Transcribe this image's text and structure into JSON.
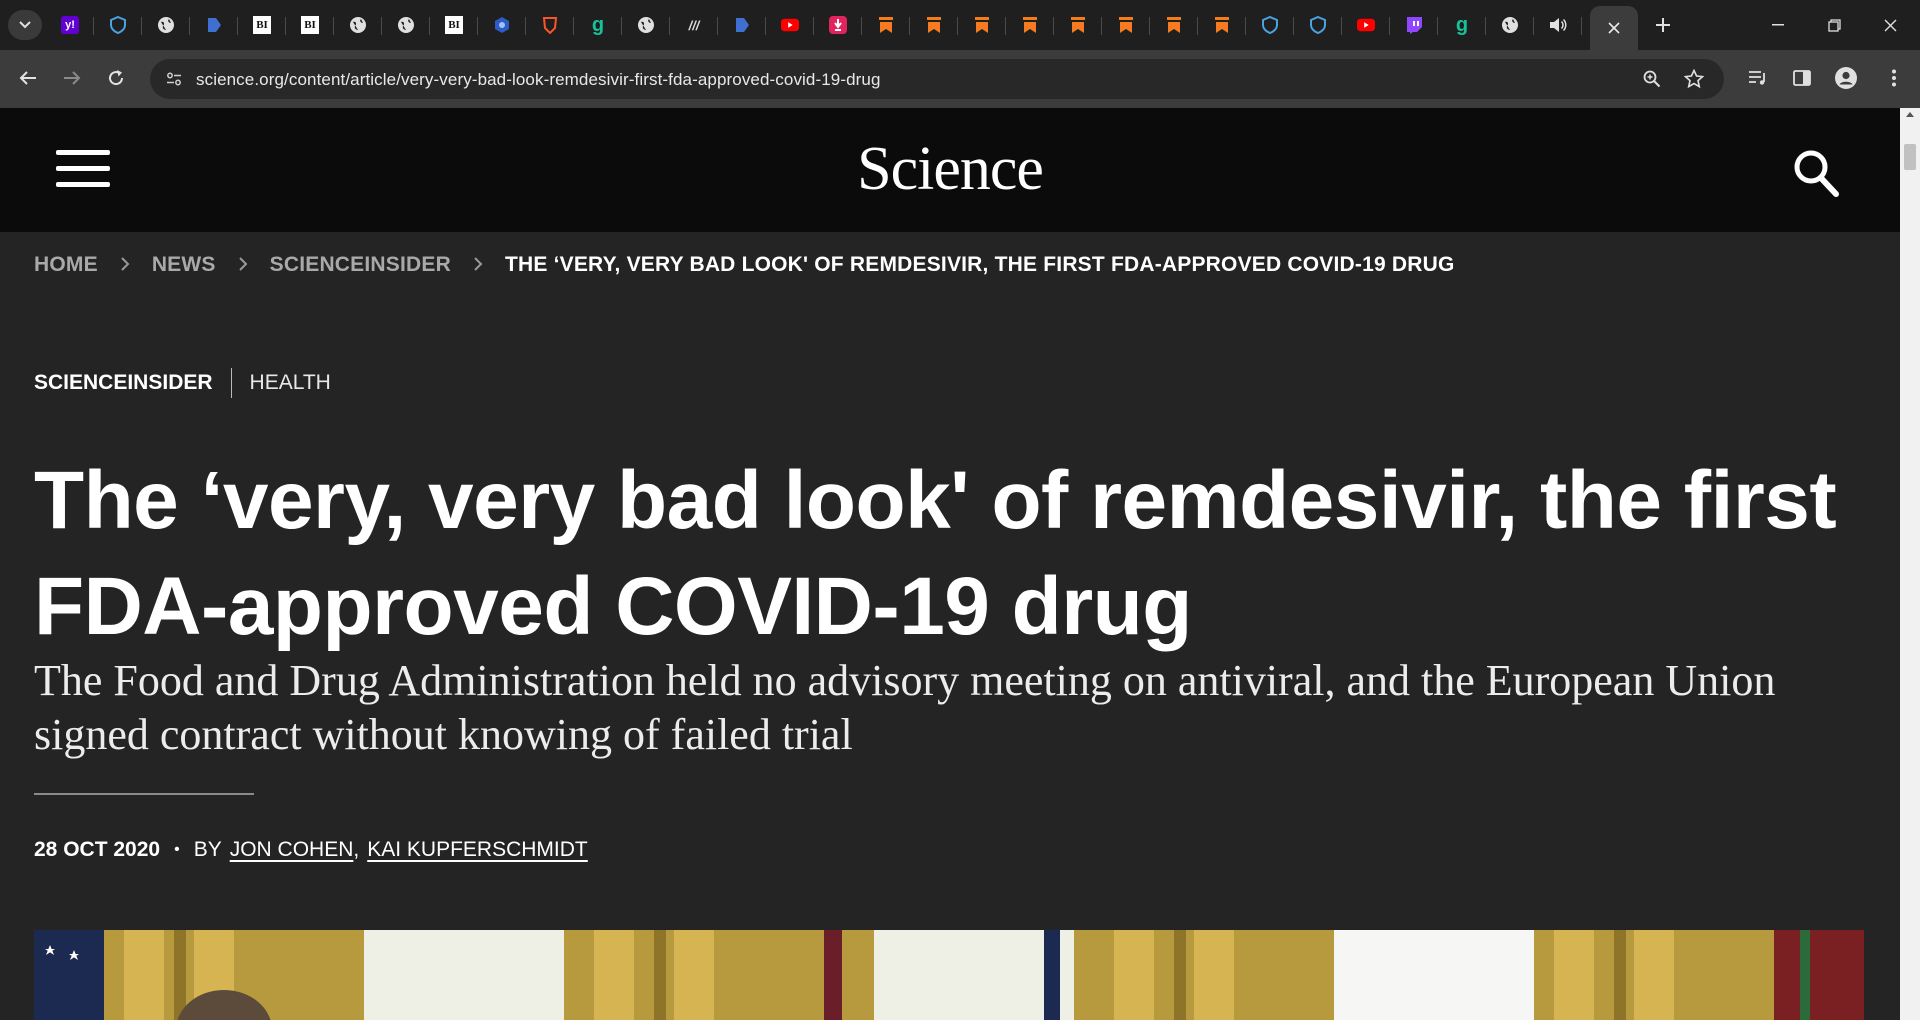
{
  "browser": {
    "tabs": [
      {
        "icon": "yahoo-icon",
        "glyph": "y!",
        "color": "#6001d2"
      },
      {
        "icon": "shield-icon",
        "glyph": "",
        "color": "#1f1f1f"
      },
      {
        "icon": "globe-icon",
        "glyph": "",
        "color": "#1f1f1f"
      },
      {
        "icon": "arrow-tab-icon",
        "glyph": "",
        "color": "#1f1f1f"
      },
      {
        "icon": "business-insider-icon",
        "glyph": "BI",
        "color": "#ffffff"
      },
      {
        "icon": "business-insider-icon",
        "glyph": "BI",
        "color": "#ffffff"
      },
      {
        "icon": "globe-icon",
        "glyph": "",
        "color": "#1f1f1f"
      },
      {
        "icon": "globe-icon",
        "glyph": "",
        "color": "#1f1f1f"
      },
      {
        "icon": "business-insider-icon",
        "glyph": "BI",
        "color": "#ffffff"
      },
      {
        "icon": "hexagon-icon",
        "glyph": "",
        "color": "#1f1f1f"
      },
      {
        "icon": "brave-shield-icon",
        "glyph": "",
        "color": "#1f1f1f"
      },
      {
        "icon": "grammarly-g-icon",
        "glyph": "g",
        "color": "#1f1f1f"
      },
      {
        "icon": "globe-icon",
        "glyph": "",
        "color": "#1f1f1f"
      },
      {
        "icon": "slash-tab-icon",
        "glyph": "",
        "color": "#1f1f1f"
      },
      {
        "icon": "arrow-tab-icon",
        "glyph": "",
        "color": "#1f1f1f"
      },
      {
        "icon": "youtube-icon",
        "glyph": "",
        "color": "#1f1f1f"
      },
      {
        "icon": "red-badge-icon",
        "glyph": "",
        "color": "#1f1f1f"
      },
      {
        "icon": "bookmark-orange-icon",
        "glyph": "",
        "color": "#1f1f1f"
      },
      {
        "icon": "bookmark-orange-icon",
        "glyph": "",
        "color": "#1f1f1f"
      },
      {
        "icon": "bookmark-orange-icon",
        "glyph": "",
        "color": "#1f1f1f"
      },
      {
        "icon": "bookmark-orange-icon",
        "glyph": "",
        "color": "#1f1f1f"
      },
      {
        "icon": "bookmark-orange-icon",
        "glyph": "",
        "color": "#1f1f1f"
      },
      {
        "icon": "bookmark-orange-icon",
        "glyph": "",
        "color": "#1f1f1f"
      },
      {
        "icon": "bookmark-orange-icon",
        "glyph": "",
        "color": "#1f1f1f"
      },
      {
        "icon": "bookmark-orange-icon",
        "glyph": "",
        "color": "#1f1f1f"
      },
      {
        "icon": "shield-icon",
        "glyph": "",
        "color": "#1f1f1f"
      },
      {
        "icon": "shield-icon",
        "glyph": "",
        "color": "#1f1f1f"
      },
      {
        "icon": "youtube-icon",
        "glyph": "",
        "color": "#1f1f1f"
      },
      {
        "icon": "twitch-icon",
        "glyph": "",
        "color": "#1f1f1f"
      },
      {
        "icon": "grammarly-g-icon",
        "glyph": "g",
        "color": "#1f1f1f"
      },
      {
        "icon": "globe-icon",
        "glyph": "",
        "color": "#1f1f1f"
      },
      {
        "icon": "speaker-icon",
        "glyph": "",
        "color": "#1f1f1f"
      }
    ],
    "url": "science.org/content/article/very-very-bad-look-remdesivir-first-fda-approved-covid-19-drug"
  },
  "site": {
    "logo": "Science"
  },
  "breadcrumb": {
    "home": "HOME",
    "news": "NEWS",
    "section": "SCIENCEINSIDER",
    "current": "THE ‘VERY, VERY BAD LOOK' OF REMDESIVIR, THE FIRST FDA-APPROVED COVID-19 DRUG"
  },
  "article": {
    "kicker_primary": "SCIENCEINSIDER",
    "kicker_secondary": "HEALTH",
    "title": "The ‘very, very bad look' of remdesivir, the first FDA-approved COVID-19 drug",
    "dek": "The Food and Drug Administration held no advisory meeting on antiviral, and the European Union signed contract without knowing of failed trial",
    "date": "28 OCT 2020",
    "by_label": "BY",
    "authors": [
      "JON COHEN",
      "KAI KUPFERSCHMIDT"
    ],
    "author_separator": ","
  }
}
